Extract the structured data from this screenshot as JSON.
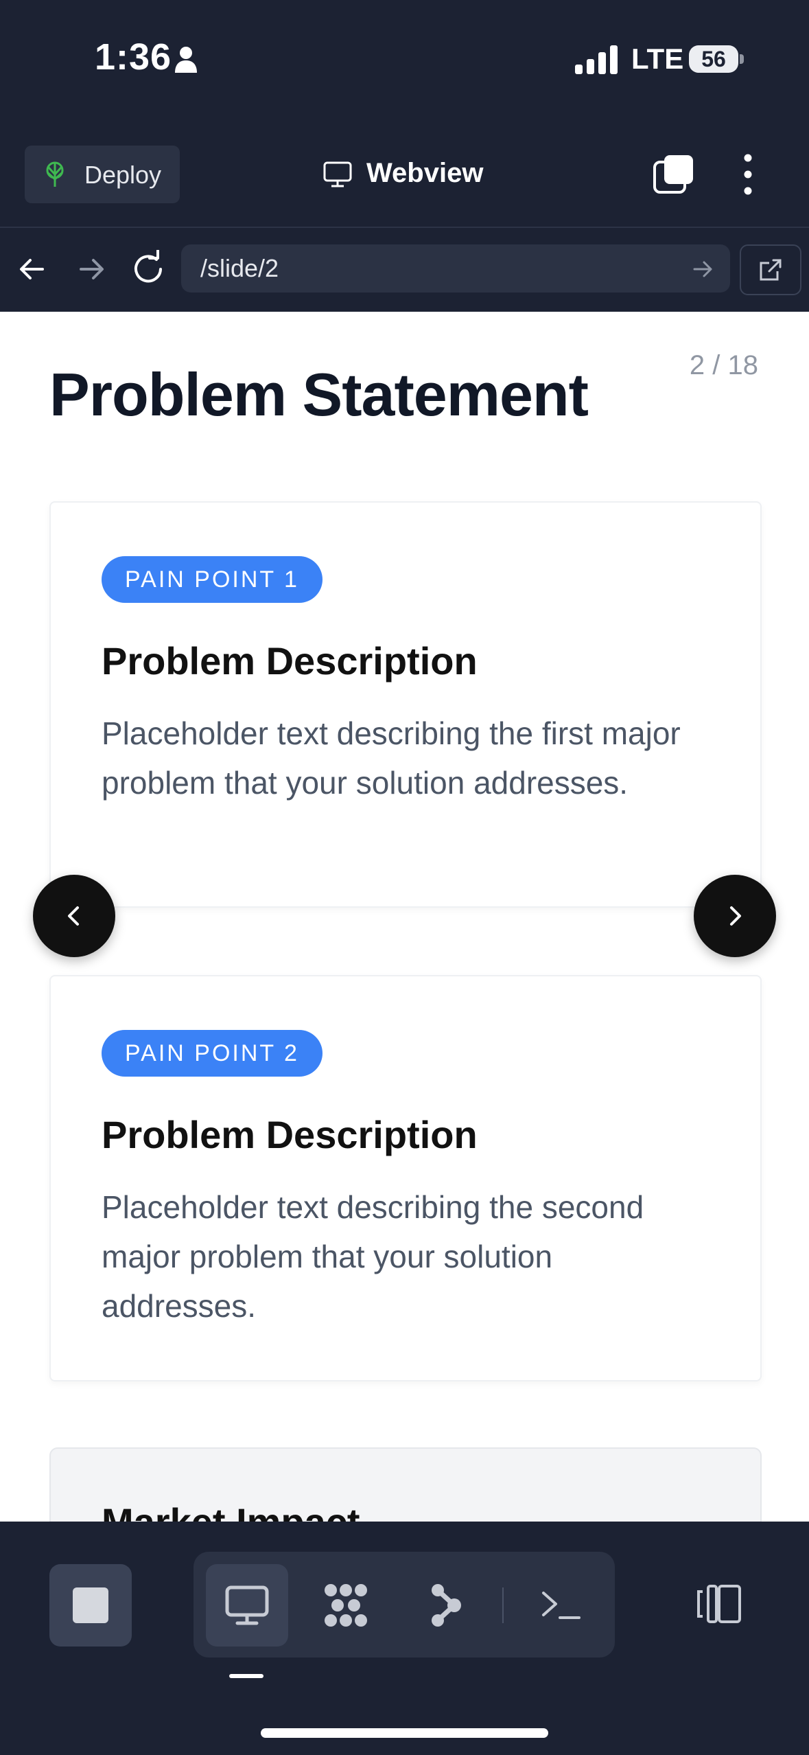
{
  "status_bar": {
    "time": "1:36",
    "network": "LTE",
    "battery": "56"
  },
  "header": {
    "deploy_label": "Deploy",
    "title": "Webview"
  },
  "url_bar": {
    "path": "/slide/2"
  },
  "slide": {
    "counter": "2 / 18",
    "title": "Problem Statement",
    "cards": [
      {
        "badge": "PAIN POINT 1",
        "heading": "Problem Description",
        "body": "Placeholder text describing the first major problem that your solution addresses."
      },
      {
        "badge": "PAIN POINT 2",
        "heading": "Problem Description",
        "body": "Placeholder text describing the second major problem that your solution addresses."
      }
    ],
    "partial_card_heading": "Market Impact"
  },
  "colors": {
    "background": "#1c2233",
    "accent": "#3b82f6",
    "deploy_icon": "#3fb950"
  },
  "icons": [
    "person-icon",
    "signal-icon",
    "battery-icon",
    "deploy-icon",
    "monitor-icon",
    "tabs-icon",
    "kebab-icon",
    "back-icon",
    "forward-icon",
    "reload-icon",
    "go-icon",
    "external-link-icon",
    "chevron-left-icon",
    "chevron-right-icon",
    "stop-icon",
    "desktop-icon",
    "cluster-icon",
    "graph-icon",
    "terminal-icon",
    "panel-icon"
  ]
}
